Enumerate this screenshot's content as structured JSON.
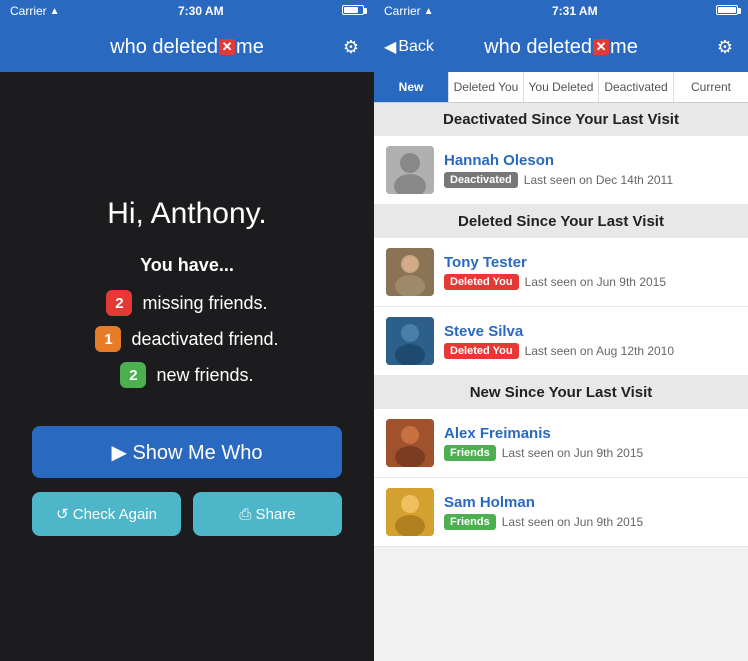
{
  "left": {
    "statusBar": {
      "carrier": "Carrier",
      "wifi": "wifi",
      "time": "7:30 AM",
      "battery": "battery"
    },
    "header": {
      "logo": "who deleted",
      "logoX": "✕",
      "logoAfter": "me",
      "gear": "⚙"
    },
    "main": {
      "greeting": "Hi, Anthony.",
      "youHave": "You have...",
      "stats": [
        {
          "badge": "2",
          "badgeColor": "red",
          "label": "missing friends."
        },
        {
          "badge": "1",
          "badgeColor": "orange",
          "label": "deactivated friend."
        },
        {
          "badge": "2",
          "badgeColor": "green",
          "label": "new friends."
        }
      ],
      "showBtn": "▶ Show Me Who",
      "checkBtn": "↺ Check Again",
      "shareBtn": "⎙ Share"
    }
  },
  "right": {
    "statusBar": {
      "carrier": "Carrier",
      "wifi": "wifi",
      "time": "7:31 AM",
      "battery": "battery"
    },
    "header": {
      "back": "◀ Back",
      "logo": "who deleted",
      "logoX": "✕",
      "logoAfter": "me",
      "gear": "⚙"
    },
    "tabs": [
      {
        "label": "New",
        "active": false
      },
      {
        "label": "Deleted You",
        "active": false
      },
      {
        "label": "You Deleted",
        "active": false
      },
      {
        "label": "Deactivated",
        "active": true
      },
      {
        "label": "Current",
        "active": false
      }
    ],
    "sections": [
      {
        "title": "Deactivated Since Your Last Visit",
        "people": [
          {
            "name": "Hannah Oleson",
            "tag": "Deactivated",
            "tagType": "deactivated",
            "lastSeen": "Last seen on Dec 14th 2011",
            "avatarType": "silhouette"
          }
        ]
      },
      {
        "title": "Deleted Since Your Last Visit",
        "people": [
          {
            "name": "Tony Tester",
            "tag": "Deleted You",
            "tagType": "deleted",
            "lastSeen": "Last seen on Jun 9th 2015",
            "avatarType": "tony"
          },
          {
            "name": "Steve Silva",
            "tag": "Deleted You",
            "tagType": "deleted",
            "lastSeen": "Last seen on Aug 12th 2010",
            "avatarType": "steve"
          }
        ]
      },
      {
        "title": "New Since Your Last Visit",
        "people": [
          {
            "name": "Alex Freimanis",
            "tag": "Friends",
            "tagType": "friends",
            "lastSeen": "Last seen on Jun 9th 2015",
            "avatarType": "alex"
          },
          {
            "name": "Sam Holman",
            "tag": "Friends",
            "tagType": "friends",
            "lastSeen": "Last seen on Jun 9th 2015",
            "avatarType": "sam"
          }
        ]
      }
    ]
  }
}
